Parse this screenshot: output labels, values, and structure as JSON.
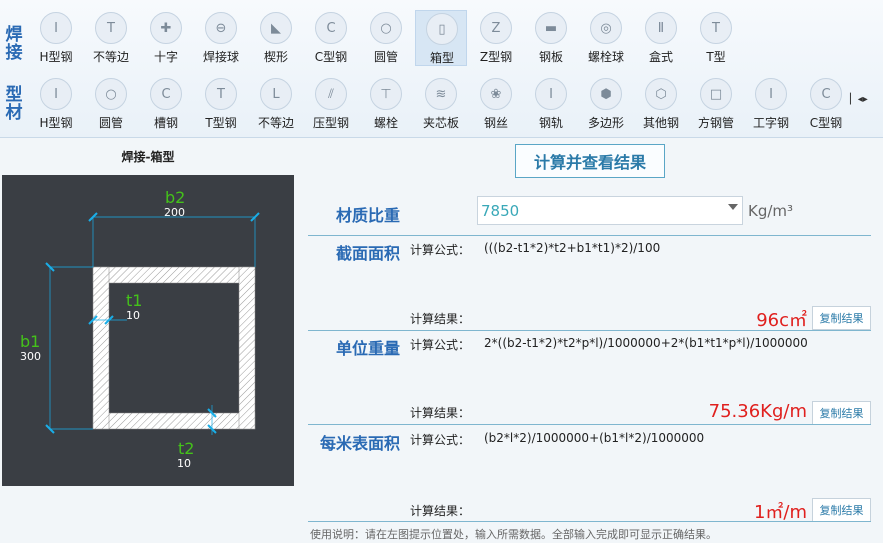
{
  "toolbar": {
    "row1_label": "焊接",
    "row2_label": "型材",
    "row1_items": [
      {
        "label": "H型钢",
        "icon": "h-beam-icon",
        "glyph": "I"
      },
      {
        "label": "不等边",
        "icon": "unequal-angle-icon",
        "glyph": "T"
      },
      {
        "label": "十字",
        "icon": "cross-icon",
        "glyph": "✚"
      },
      {
        "label": "焊接球",
        "icon": "weld-ball-icon",
        "glyph": "⊖"
      },
      {
        "label": "楔形",
        "icon": "wedge-icon",
        "glyph": "◣"
      },
      {
        "label": "C型钢",
        "icon": "c-channel-icon",
        "glyph": "C"
      },
      {
        "label": "圆管",
        "icon": "round-tube-icon",
        "glyph": "○"
      },
      {
        "label": "箱型",
        "icon": "box-section-icon",
        "glyph": "▯"
      },
      {
        "label": "Z型钢",
        "icon": "z-section-icon",
        "glyph": "Z"
      },
      {
        "label": "钢板",
        "icon": "steel-plate-icon",
        "glyph": "▬"
      },
      {
        "label": "螺栓球",
        "icon": "bolt-ball-icon",
        "glyph": "◎"
      },
      {
        "label": "盒式",
        "icon": "box-type-icon",
        "glyph": "Ⅱ"
      },
      {
        "label": "T型",
        "icon": "t-section-icon",
        "glyph": "T"
      }
    ],
    "row2_items": [
      {
        "label": "H型钢",
        "icon": "h-beam-icon",
        "glyph": "I"
      },
      {
        "label": "圆管",
        "icon": "round-tube-icon",
        "glyph": "○"
      },
      {
        "label": "槽钢",
        "icon": "channel-icon",
        "glyph": "C"
      },
      {
        "label": "T型钢",
        "icon": "t-beam-icon",
        "glyph": "T"
      },
      {
        "label": "不等边",
        "icon": "unequal-angle-icon",
        "glyph": "L"
      },
      {
        "label": "压型钢",
        "icon": "profiled-steel-icon",
        "glyph": "⫽"
      },
      {
        "label": "螺栓",
        "icon": "bolt-icon",
        "glyph": "⊤"
      },
      {
        "label": "夹芯板",
        "icon": "sandwich-panel-icon",
        "glyph": "≋"
      },
      {
        "label": "钢丝",
        "icon": "steel-wire-icon",
        "glyph": "❀"
      },
      {
        "label": "钢轨",
        "icon": "rail-icon",
        "glyph": "I"
      },
      {
        "label": "多边形",
        "icon": "polygon-icon",
        "glyph": "⬢"
      },
      {
        "label": "其他钢",
        "icon": "other-steel-icon",
        "glyph": "⬡"
      },
      {
        "label": "方钢管",
        "icon": "square-tube-icon",
        "glyph": "□"
      },
      {
        "label": "工字钢",
        "icon": "i-beam-icon",
        "glyph": "I"
      },
      {
        "label": "C型钢",
        "icon": "c-channel-icon",
        "glyph": "C"
      }
    ],
    "selected_index": 7
  },
  "left": {
    "title": "焊接-箱型",
    "labels": {
      "b2": "b2",
      "b2_value": "200",
      "b1": "b1",
      "b1_value": "300",
      "t1": "t1",
      "t1_value": "10",
      "t2": "t2",
      "t2_value": "10"
    },
    "colors": {
      "label_green": "#44c21a",
      "dim_line": "#19aee8",
      "bg": "#3a3e44"
    }
  },
  "main": {
    "calc_button": "计算并查看结果",
    "density_title": "材质比重",
    "density_value": "7850",
    "density_unit": "Kg/m³",
    "formula_label": "计算公式：",
    "result_label": "计算结果：",
    "copy_label": "复制结果",
    "sections": [
      {
        "title": "截面面积",
        "formula": "(((b2-t1*2)*t2+b1*t1)*2)/100",
        "result": "96c㎡"
      },
      {
        "title": "单位重量",
        "formula": "2*((b2-t1*2)*t2*p*l)/1000000+2*(b1*t1*p*l)/1000000",
        "result": "75.36Kg/m"
      },
      {
        "title": "每米表面积",
        "formula": "(b2*l*2)/1000000+(b1*l*2)/1000000",
        "result": "1㎡/m"
      }
    ],
    "usage": "使用说明：请在左图提示位置处，输入所需数据。全部输入完成即可显示正确结果。",
    "accent_color": "#2a6ab4",
    "result_color": "#e0201e"
  }
}
